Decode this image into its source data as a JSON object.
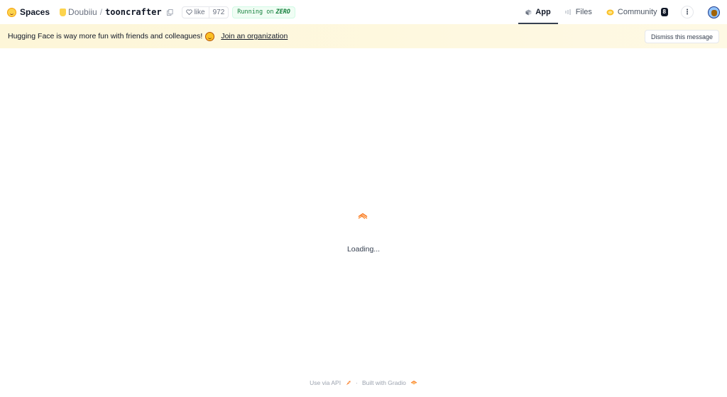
{
  "header": {
    "brand": "Spaces",
    "owner": "Doubiiu",
    "separator": "/",
    "repo_name": "tooncrafter",
    "like_label": "like",
    "like_count": "972",
    "running_prefix": "Running on",
    "running_hw": "ZERO"
  },
  "nav": {
    "tabs": [
      {
        "label": "App",
        "active": true
      },
      {
        "label": "Files",
        "active": false
      },
      {
        "label": "Community",
        "active": false,
        "badge": "8"
      }
    ],
    "more_label": "⋮"
  },
  "banner": {
    "message": "Hugging Face is way more fun with friends and colleagues!",
    "link": "Join an organization",
    "dismiss": "Dismiss this message"
  },
  "main": {
    "loading": "Loading..."
  },
  "footer": {
    "api": "Use via API",
    "separator": "·",
    "built": "Built with Gradio"
  },
  "colors": {
    "accent": "#f97316",
    "banner_bg": "#fdf6d8",
    "running_green": "#15803d"
  },
  "icons": [
    "hf-logo-icon",
    "copy-icon",
    "heart-icon",
    "app-icon",
    "files-icon",
    "community-icon",
    "rocket-icon",
    "gradio-logo-icon"
  ]
}
